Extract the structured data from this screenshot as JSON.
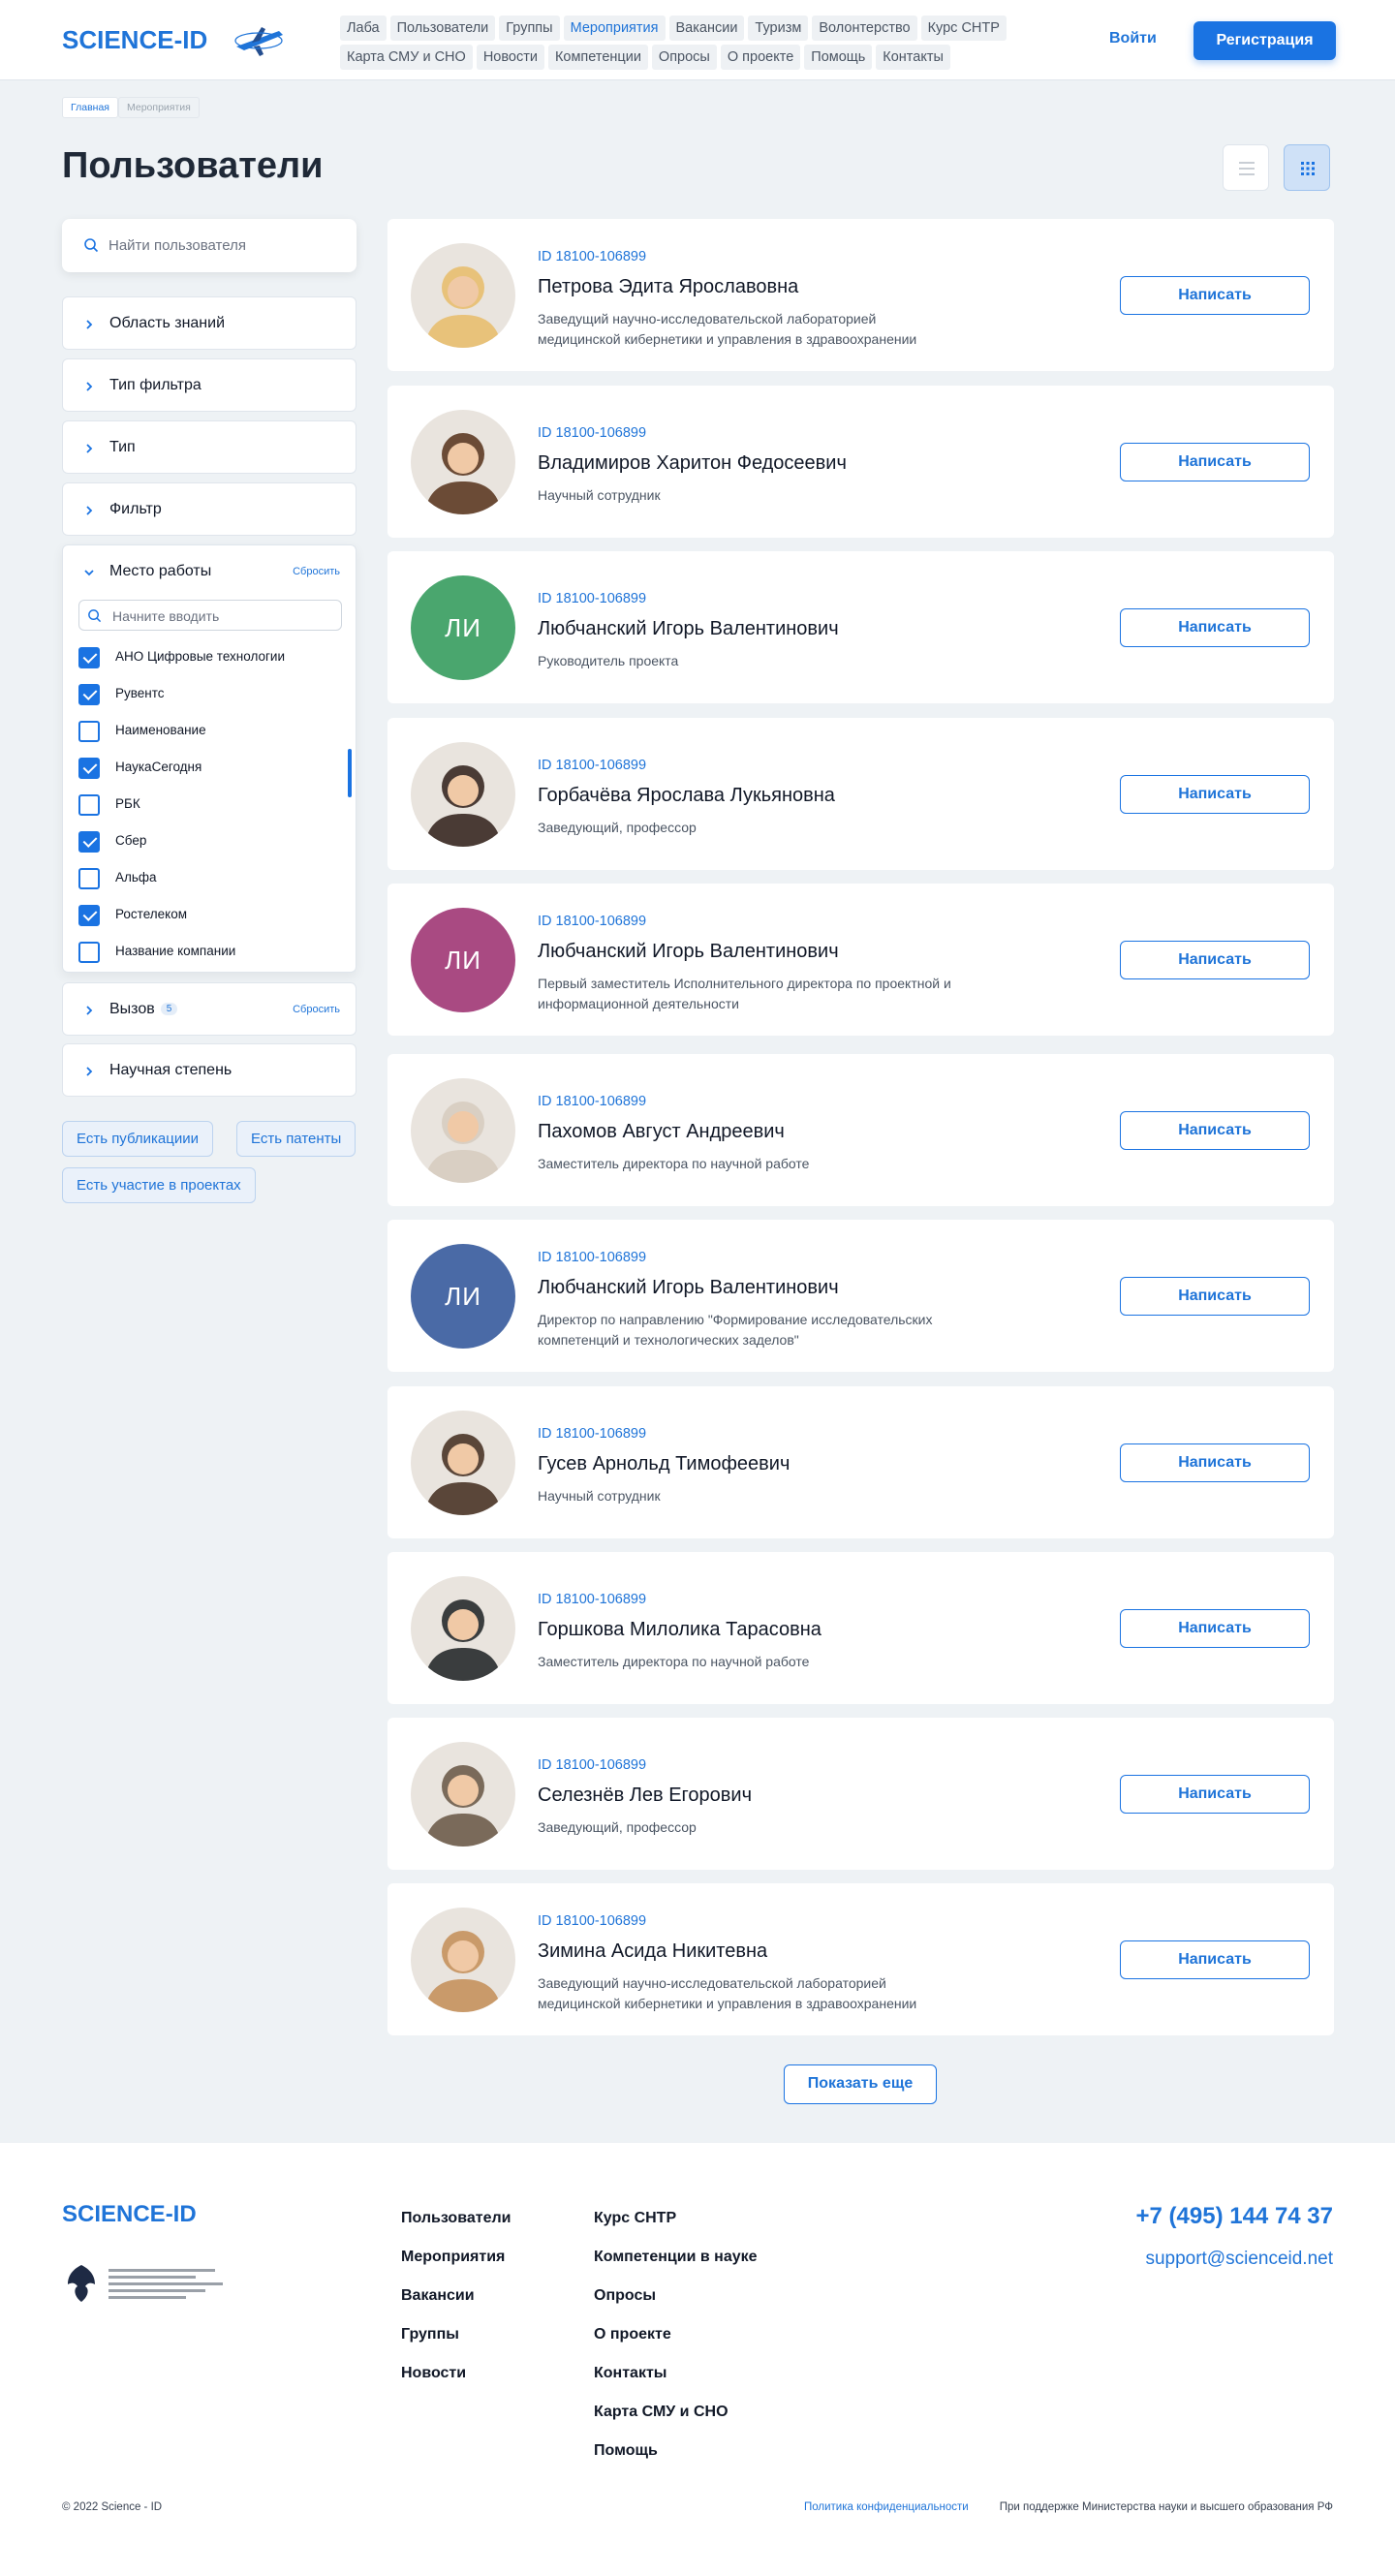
{
  "header": {
    "logo": "SCIENCE-ID",
    "nav": [
      "Лаба",
      "Пользователи",
      "Группы",
      "Мероприятия",
      "Вакансии",
      "Туризм",
      "Волонтерство",
      "Курс СНТР",
      "Карта СМУ и СНО",
      "Новости",
      "Компетенции",
      "Опросы",
      "О проекте",
      "Помощь",
      "Контакты"
    ],
    "active_nav": "Мероприятия",
    "login": "Войти",
    "register": "Регистрация"
  },
  "breadcrumbs": [
    "Главная",
    "Мероприятия"
  ],
  "page_title": "Пользователи",
  "sidebar": {
    "search_placeholder": "Найти пользователя",
    "filters": [
      "Область знаний",
      "Тип фильтра",
      "Тип",
      "Фильтр"
    ],
    "workplace": {
      "label": "Место работы",
      "reset": "Сбросить",
      "input_placeholder": "Начните вводить",
      "options": [
        {
          "label": "АНО Цифровые технологии",
          "checked": true
        },
        {
          "label": "Рувентс",
          "checked": true
        },
        {
          "label": "Наименование",
          "checked": false
        },
        {
          "label": "НаукаСегодня",
          "checked": true
        },
        {
          "label": "РБК",
          "checked": false
        },
        {
          "label": "Сбер",
          "checked": true
        },
        {
          "label": "Альфа",
          "checked": false
        },
        {
          "label": "Ростелеком",
          "checked": true
        },
        {
          "label": "Название компании",
          "checked": false
        }
      ]
    },
    "challenge": {
      "label": "Вызов",
      "count": "5",
      "reset": "Сбросить"
    },
    "degree": "Научная степень",
    "tags": [
      "Есть публикациии",
      "Есть патенты",
      "Есть участие в проектах"
    ]
  },
  "users": [
    {
      "id": "ID 18100-106899",
      "name": "Петрова Эдита Ярославовна",
      "role": "Заведущий научно-исследовательской лабораторией медицинской кибернетики и управления в здравоохранении",
      "avatar": "photo",
      "color": "#e8c27a"
    },
    {
      "id": "ID 18100-106899",
      "name": "Владимиров Харитон Федосеевич",
      "role": "Научный сотрудник",
      "avatar": "photo",
      "color": "#6b4b36"
    },
    {
      "id": "ID 18100-106899",
      "name": "Любчанский Игорь Валентинович",
      "role": "Руководитель проекта",
      "avatar": "ЛИ",
      "color": "#4aa66e"
    },
    {
      "id": "ID 18100-106899",
      "name": "Горбачёва Ярослава Лукьяновна",
      "role": "Заведующий, профессор",
      "avatar": "photo",
      "color": "#4a3b35"
    },
    {
      "id": "ID 18100-106899",
      "name": "Любчанский Игорь Валентинович",
      "role": "Первый заместитель Исполнительного директора по проектной и информационной деятельности",
      "avatar": "ЛИ",
      "color": "#a94a82"
    },
    {
      "id": "ID 18100-106899",
      "name": "Пахомов Август Андреевич",
      "role": "Заместитель директора по научной работе",
      "avatar": "photo",
      "color": "#d9cfc3"
    },
    {
      "id": "ID 18100-106899",
      "name": "Любчанский Игорь Валентинович",
      "role": "Директор по направлению \"Формирование исследовательских компетенций и технологических заделов\"",
      "avatar": "ЛИ",
      "color": "#4a6aa6"
    },
    {
      "id": "ID 18100-106899",
      "name": "Гусев Арнольд Тимофеевич",
      "role": "Научный сотрудник",
      "avatar": "photo",
      "color": "#5a4639"
    },
    {
      "id": "ID 18100-106899",
      "name": "Горшкова Милолика Тарасовна",
      "role": "Заместитель директора по научной работе",
      "avatar": "photo",
      "color": "#3a3d3e"
    },
    {
      "id": "ID 18100-106899",
      "name": "Селезнёв Лев Егорович",
      "role": "Заведующий, профессор",
      "avatar": "photo",
      "color": "#7a6a5a"
    },
    {
      "id": "ID 18100-106899",
      "name": "Зимина Асида Никитевна",
      "role": "Заведующий научно-исследовательской лабораторией медицинской кибернетики и управления в здравоохранении",
      "avatar": "photo",
      "color": "#c99a6a"
    }
  ],
  "write_label": "Написать",
  "show_more": "Показать еще",
  "footer": {
    "logo": "SCIENCE-ID",
    "col1": [
      "Пользователи",
      "Мероприятия",
      "Вакансии",
      "Группы",
      "Новости"
    ],
    "col2": [
      "Курс СНТР",
      "Компетенции в науке",
      "Опросы",
      "О проекте",
      "Контакты",
      "Карта СМУ и СНО",
      "Помощь"
    ],
    "phone": "+7 (495) 144 74 37",
    "email": "support@scienceid.net",
    "copyright": "© 2022 Science - ID",
    "policy": "Политика конфиденциальности",
    "support": "При поддержке Министерства науки и высшего образования РФ"
  }
}
